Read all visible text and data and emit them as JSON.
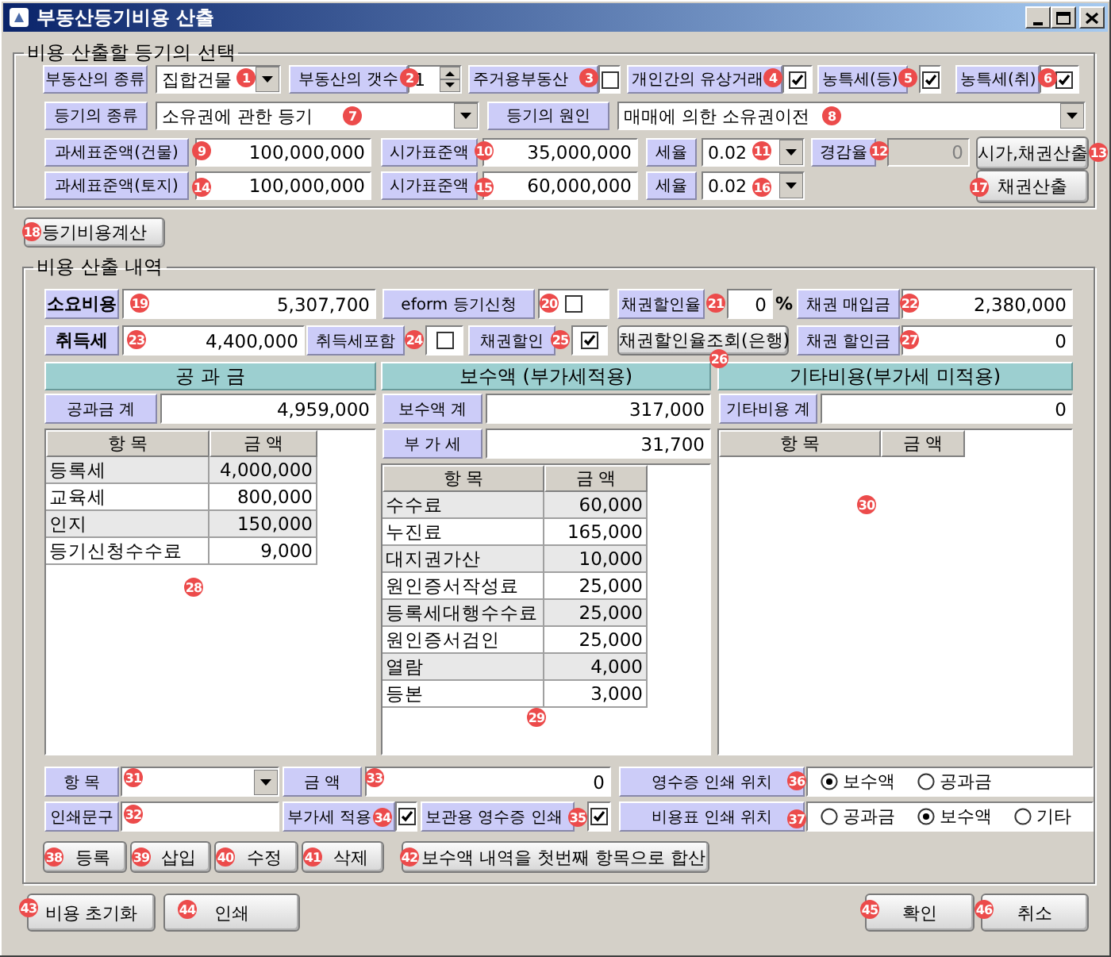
{
  "window": {
    "title": "부동산등기비용 산출"
  },
  "selection": {
    "title": "비용 산출할 등기의 선택",
    "rows": [
      {
        "items": [
          {
            "kind": "label",
            "text": "부동산의 종류"
          },
          {
            "kind": "dropdown",
            "value": "집합건물"
          },
          {
            "kind": "label",
            "text": "부동산의 갯수"
          },
          {
            "kind": "spin",
            "value": "1"
          },
          {
            "kind": "label",
            "text": "주거용부동산"
          },
          {
            "kind": "checkbox",
            "checked": false
          },
          {
            "kind": "label",
            "text": "개인간의 유상거래"
          },
          {
            "kind": "checkbox",
            "checked": true
          },
          {
            "kind": "label",
            "text": "농특세(등)"
          },
          {
            "kind": "checkbox",
            "checked": true
          },
          {
            "kind": "label",
            "text": "농특세(취)"
          },
          {
            "kind": "checkbox",
            "checked": true
          }
        ]
      },
      {
        "items": [
          {
            "kind": "label",
            "text": "등기의 종류"
          },
          {
            "kind": "dropdown",
            "value": "소유권에 관한 등기"
          },
          {
            "kind": "label",
            "text": "등기의 원인"
          },
          {
            "kind": "dropdown",
            "value": "매매에 의한 소유권이전"
          }
        ]
      },
      {
        "items": [
          {
            "kind": "label",
            "text": "과세표준액(건물)"
          },
          {
            "kind": "input",
            "value": "100,000,000",
            "disabled": false
          },
          {
            "kind": "label",
            "text": "시가표준액"
          },
          {
            "kind": "input",
            "value": "35,000,000",
            "disabled": false
          },
          {
            "kind": "label",
            "text": "세율"
          },
          {
            "kind": "dropdown",
            "value": "0.02"
          },
          {
            "kind": "label",
            "text": "경감율"
          },
          {
            "kind": "input",
            "value": "0",
            "disabled": true
          },
          {
            "kind": "button",
            "text": "시가,채권산출"
          }
        ]
      },
      {
        "items": [
          {
            "kind": "label",
            "text": "과세표준액(토지)"
          },
          {
            "kind": "input",
            "value": "100,000,000",
            "disabled": false
          },
          {
            "kind": "label",
            "text": "시가표준액"
          },
          {
            "kind": "input",
            "value": "60,000,000",
            "disabled": false
          },
          {
            "kind": "label",
            "text": "세율"
          },
          {
            "kind": "dropdown",
            "value": "0.02"
          },
          {
            "kind": "button",
            "text": "채권산출"
          }
        ]
      }
    ]
  },
  "calculate_button": {
    "label": "등기비용계산"
  },
  "details": {
    "title": "비용 산출 내역",
    "rows": [
      {
        "items": [
          {
            "kind": "label",
            "text": "소요비용",
            "bold": true
          },
          {
            "kind": "input",
            "value": "5,307,700",
            "disabled": false
          },
          {
            "kind": "label",
            "text": "eform 등기신청",
            "bold": false
          },
          {
            "kind": "checkbox",
            "checked": false
          },
          {
            "kind": "label",
            "text": "채권할인율",
            "bold": false
          },
          {
            "kind": "input",
            "value": "0",
            "disabled": false
          },
          {
            "kind": "unit",
            "text": "%"
          },
          {
            "kind": "label",
            "text": "채권 매입금",
            "bold": false
          },
          {
            "kind": "input",
            "value": "2,380,000",
            "disabled": false
          }
        ]
      },
      {
        "items": [
          {
            "kind": "label",
            "text": "취득세",
            "bold": true
          },
          {
            "kind": "input",
            "value": "4,400,000",
            "disabled": false
          },
          {
            "kind": "label",
            "text": "취득세포함",
            "bold": false
          },
          {
            "kind": "checkbox",
            "checked": false
          },
          {
            "kind": "label",
            "text": "채권할인",
            "bold": false
          },
          {
            "kind": "checkbox",
            "checked": true
          },
          {
            "kind": "button",
            "text": "채권할인율조회(은행)"
          },
          {
            "kind": "label",
            "text": "채권 할인금",
            "bold": false
          },
          {
            "kind": "input",
            "value": "0",
            "disabled": false
          }
        ]
      }
    ],
    "columns": [
      {
        "header": "공 과 금",
        "fields": [
          {
            "label": "공과금 계",
            "value": "4,959,000"
          }
        ],
        "table": {
          "columns": [
            "항 목",
            "금 액"
          ],
          "rows": [
            [
              "등록세",
              "4,000,000"
            ],
            [
              "교육세",
              "800,000"
            ],
            [
              "인지",
              "150,000"
            ],
            [
              "등기신청수수료",
              "9,000"
            ]
          ]
        }
      },
      {
        "header": "보수액 (부가세적용)",
        "fields": [
          {
            "label": "보수액 계",
            "value": "317,000"
          },
          {
            "label": "부 가 세",
            "value": "31,700"
          }
        ],
        "table": {
          "columns": [
            "항 목",
            "금 액"
          ],
          "rows": [
            [
              "수수료",
              "60,000"
            ],
            [
              "누진료",
              "165,000"
            ],
            [
              "대지권가산",
              "10,000"
            ],
            [
              "원인증서작성료",
              "25,000"
            ],
            [
              "등록세대행수수료",
              "25,000"
            ],
            [
              "원인증서검인",
              "25,000"
            ],
            [
              "열람",
              "4,000"
            ],
            [
              "등본",
              "3,000"
            ]
          ]
        }
      },
      {
        "header": "기타비용(부가세 미적용)",
        "fields": [
          {
            "label": "기타비용 계",
            "value": "0"
          }
        ],
        "table": {
          "columns": [
            "항 목",
            "금 액"
          ]
        }
      }
    ],
    "entry_rows": [
      {
        "items": [
          {
            "kind": "label",
            "text": "항 목"
          },
          {
            "kind": "dropdown"
          },
          {
            "kind": "label",
            "text": "금 액"
          },
          {
            "kind": "input",
            "value": "0",
            "disabled": false
          },
          {
            "kind": "label",
            "text": "영수증 인쇄 위치"
          },
          {
            "kind": "radio_group",
            "options": [
              {
                "label": "보수액",
                "selected": true
              },
              {
                "label": "공과금",
                "selected": false
              }
            ]
          }
        ]
      },
      {
        "items": [
          {
            "kind": "label",
            "text": "인쇄문구"
          },
          {
            "kind": "input",
            "disabled": false
          },
          {
            "kind": "label",
            "text": "부가세 적용"
          },
          {
            "kind": "checkbox",
            "checked": true
          },
          {
            "kind": "label",
            "text": "보관용 영수증 인쇄"
          },
          {
            "kind": "checkbox",
            "checked": true
          },
          {
            "kind": "label",
            "text": "비용표 인쇄 위치"
          },
          {
            "kind": "radio_group",
            "options": [
              {
                "label": "공과금",
                "selected": false
              },
              {
                "label": "보수액",
                "selected": true
              },
              {
                "label": "기타",
                "selected": false
              }
            ]
          }
        ]
      }
    ],
    "action_buttons": [
      "등록",
      "삽입",
      "수정",
      "삭제",
      "보수액 내역을 첫번째 항목으로 합산"
    ]
  },
  "footer_buttons": [
    "비용 초기화",
    "인쇄",
    "확인",
    "취소"
  ],
  "callouts": [
    "1",
    "2",
    "3",
    "4",
    "5",
    "6",
    "7",
    "8",
    "9",
    "10",
    "11",
    "12",
    "13",
    "14",
    "15",
    "16",
    "17",
    "18",
    "19",
    "20",
    "21",
    "22",
    "23",
    "24",
    "25",
    "26",
    "27",
    "28",
    "29",
    "30",
    "31",
    "32",
    "33",
    "34",
    "35",
    "36",
    "37",
    "38",
    "39",
    "40",
    "41",
    "42",
    "43",
    "44",
    "45",
    "46"
  ]
}
